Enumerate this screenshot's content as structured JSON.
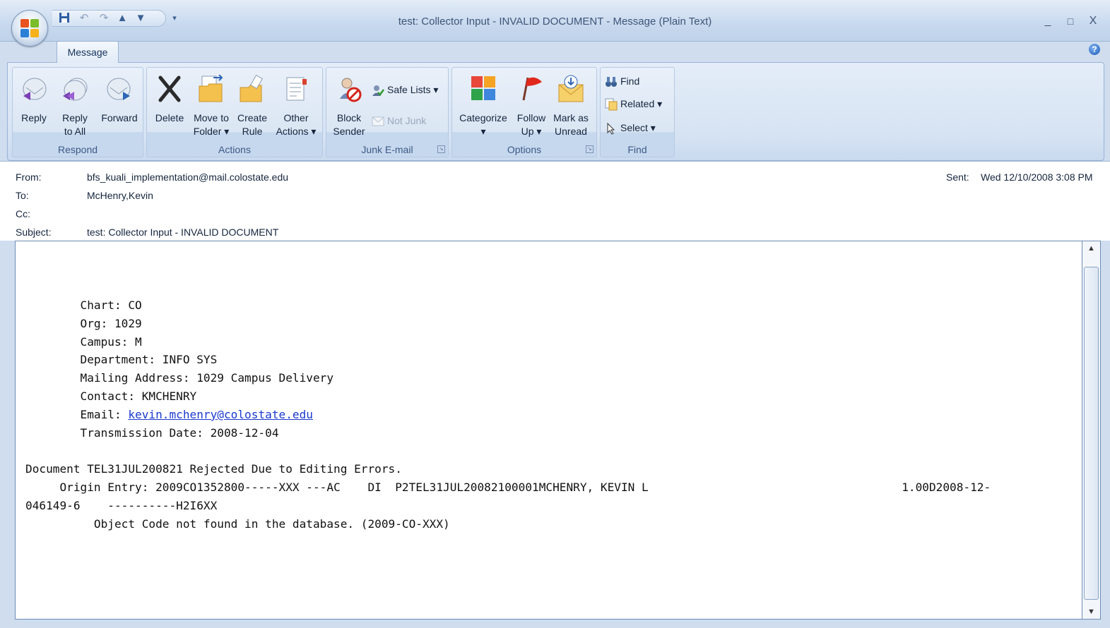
{
  "window": {
    "title": "test: Collector Input - INVALID DOCUMENT - Message (Plain Text)",
    "minimize": "_",
    "maximize": "□",
    "close": "X"
  },
  "ribbon": {
    "tab": "Message",
    "groups": {
      "respond": {
        "label": "Respond",
        "reply": "Reply",
        "reply_all_1": "Reply",
        "reply_all_2": "to All",
        "forward": "Forward"
      },
      "actions": {
        "label": "Actions",
        "delete": "Delete",
        "move_1": "Move to",
        "move_2": "Folder ▾",
        "create_1": "Create",
        "create_2": "Rule",
        "other_1": "Other",
        "other_2": "Actions ▾"
      },
      "junk": {
        "label": "Junk E-mail",
        "block_1": "Block",
        "block_2": "Sender",
        "safe_lists": "Safe Lists ▾",
        "not_junk": "Not Junk"
      },
      "options": {
        "label": "Options",
        "categorize_1": "Categorize",
        "categorize_2": "▾",
        "follow_1": "Follow",
        "follow_2": "Up ▾",
        "mark_1": "Mark as",
        "mark_2": "Unread"
      },
      "find": {
        "label": "Find",
        "find": "Find",
        "related": "Related ▾",
        "select": "Select ▾"
      }
    }
  },
  "headers": {
    "from_label": "From:",
    "from_value": "bfs_kuali_implementation@mail.colostate.edu",
    "to_label": "To:",
    "to_value": "McHenry,Kevin",
    "cc_label": "Cc:",
    "cc_value": "",
    "subject_label": "Subject:",
    "subject_value": "test: Collector Input - INVALID DOCUMENT",
    "sent_label": "Sent:",
    "sent_value": "Wed 12/10/2008 3:08 PM"
  },
  "body": {
    "chart": "        Chart: CO",
    "org": "        Org: 1029",
    "campus": "        Campus: M",
    "department": "        Department: INFO SYS",
    "mailing": "        Mailing Address: 1029 Campus Delivery",
    "contact": "        Contact: KMCHENRY",
    "email_prefix": "        Email: ",
    "email_link": "kevin.mchenry@colostate.edu",
    "transmission": "        Transmission Date: 2008-12-04",
    "rejected": "Document TEL31JUL200821 Rejected Due to Editing Errors.",
    "origin": "     Origin Entry: 2009CO1352800-----XXX ---AC    DI  P2TEL31JUL20082100001MCHENRY, KEVIN L                                     1.00D2008-12-",
    "origin_cont": "046149-6    ----------H2I6XX",
    "object_error": "          Object Code not found in the database. (2009-CO-XXX)"
  }
}
